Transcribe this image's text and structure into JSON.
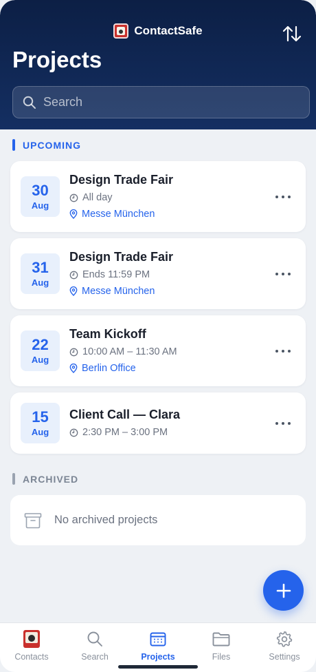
{
  "app": {
    "name": "ContactSafe"
  },
  "header": {
    "title": "Projects"
  },
  "search": {
    "placeholder": "Search"
  },
  "sections": {
    "upcoming": "UPCOMING",
    "archived": "ARCHIVED"
  },
  "events": [
    {
      "day": "30",
      "month": "Aug",
      "title": "Design Trade Fair",
      "time": "All day",
      "location": "Messe München"
    },
    {
      "day": "31",
      "month": "Aug",
      "title": "Design Trade Fair",
      "time": "Ends 11:59 PM",
      "location": "Messe München"
    },
    {
      "day": "22",
      "month": "Aug",
      "title": "Team Kickoff",
      "time": "10:00 AM – 11:30 AM",
      "location": "Berlin Office"
    },
    {
      "day": "15",
      "month": "Aug",
      "title": "Client Call — Clara",
      "time": "2:30 PM – 3:00 PM"
    }
  ],
  "archived": {
    "empty_text": "No archived projects"
  },
  "tabs": [
    {
      "label": "Contacts",
      "icon": "contacts-logo-icon"
    },
    {
      "label": "Search",
      "icon": "search-icon"
    },
    {
      "label": "Projects",
      "icon": "calendar-icon",
      "active": true
    },
    {
      "label": "Files",
      "icon": "folder-icon"
    },
    {
      "label": "Settings",
      "icon": "gear-icon"
    }
  ],
  "colors": {
    "accent": "#2563eb",
    "header": "#0c1f45",
    "background": "#eef1f5"
  }
}
